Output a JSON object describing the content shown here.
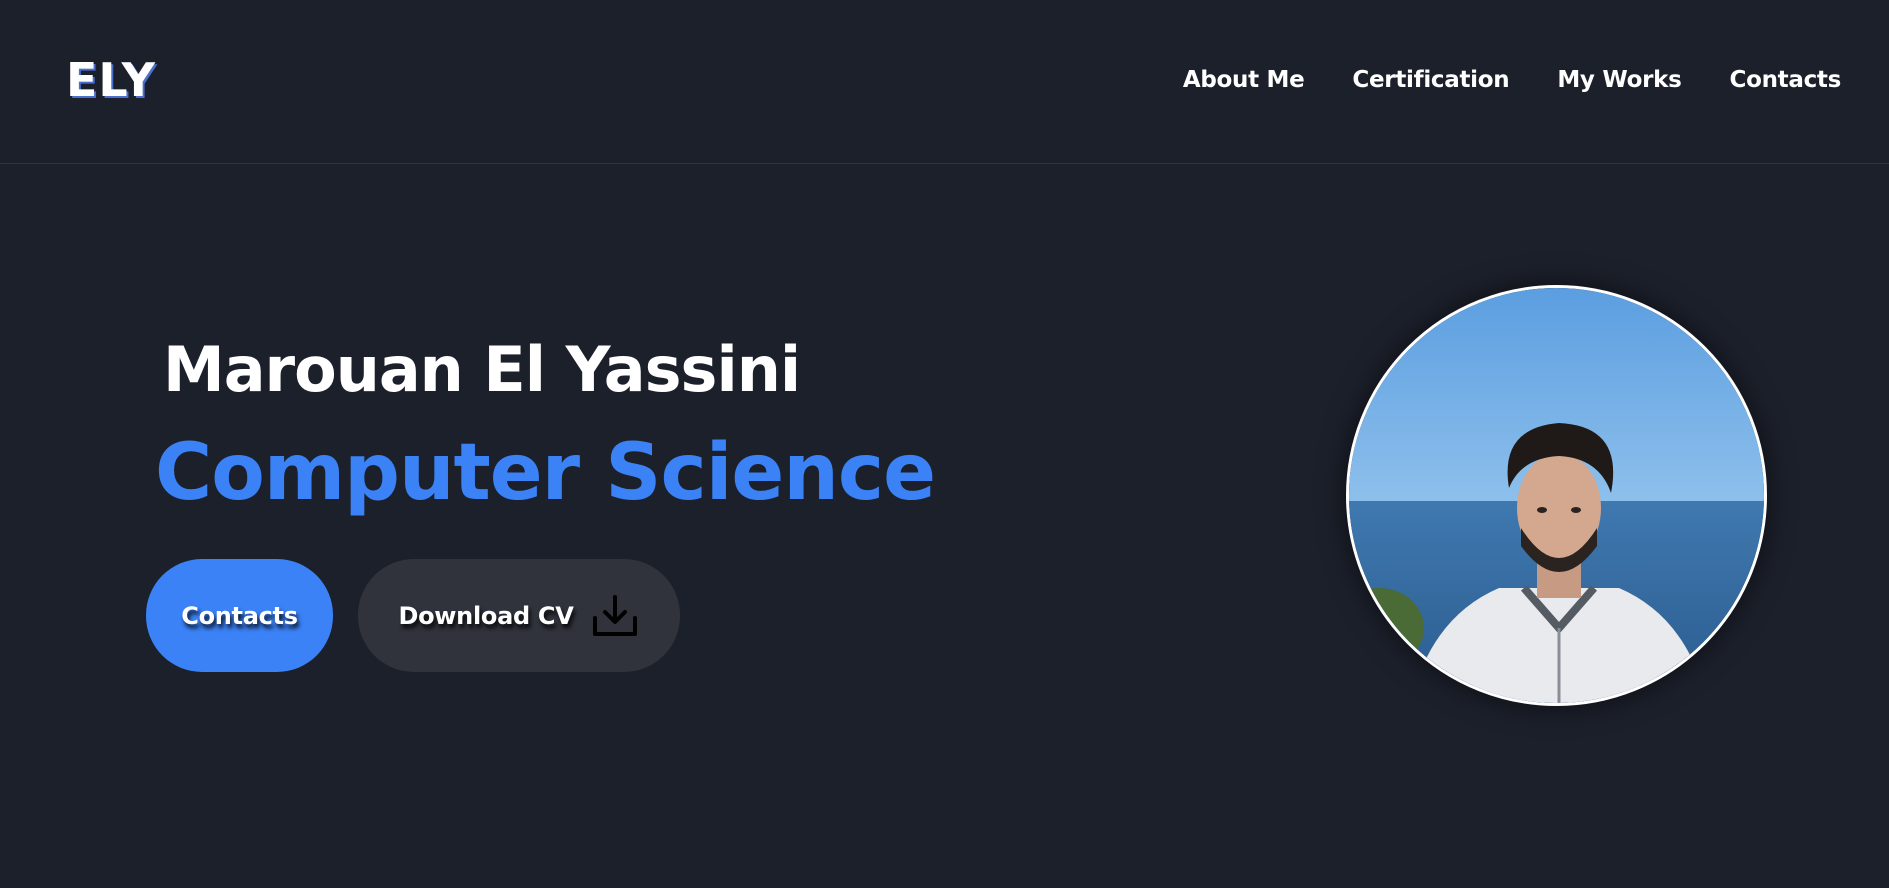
{
  "header": {
    "logo": "ELY",
    "nav": [
      {
        "label": "About Me"
      },
      {
        "label": "Certification"
      },
      {
        "label": "My Works"
      },
      {
        "label": "Contacts"
      }
    ]
  },
  "hero": {
    "name": "Marouan El Yassini",
    "role": "Computer Science",
    "buttons": {
      "contacts_label": "Contacts",
      "download_label": "Download CV"
    }
  },
  "avatar": {
    "alt": "Marouan El Yassini"
  },
  "colors": {
    "background": "#1c202b",
    "accent": "#3b82f6",
    "button_secondary": "#30333c",
    "text": "#ffffff"
  },
  "icons": {
    "download": "download-icon"
  }
}
